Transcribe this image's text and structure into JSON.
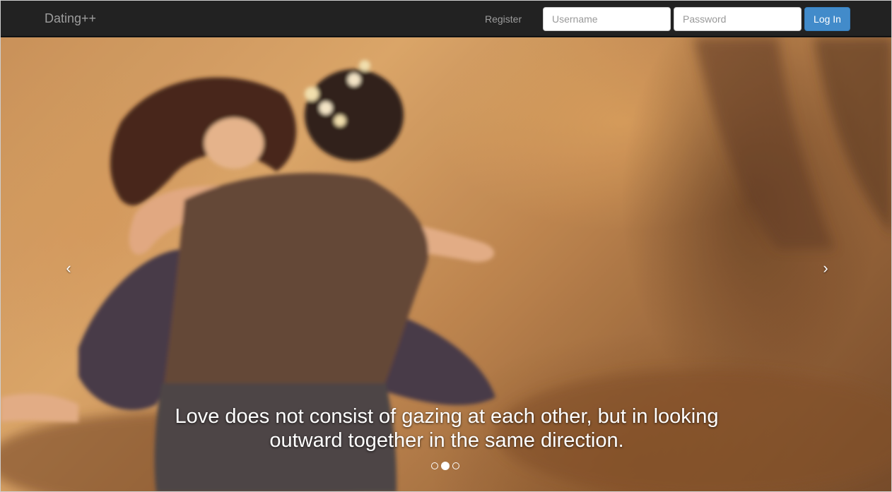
{
  "navbar": {
    "brand": "Dating++",
    "register_label": "Register",
    "username_placeholder": "Username",
    "password_placeholder": "Password",
    "login_label": "Log In"
  },
  "carousel": {
    "caption": "Love does not consist of gazing at each other, but in looking outward together in the same direction.",
    "prev_icon": "‹",
    "next_icon": "›",
    "slide_count": 3,
    "active_slide": 2
  },
  "colors": {
    "navbar_bg": "#222222",
    "navbar_text": "#9d9d9d",
    "button_primary": "#428bca"
  }
}
